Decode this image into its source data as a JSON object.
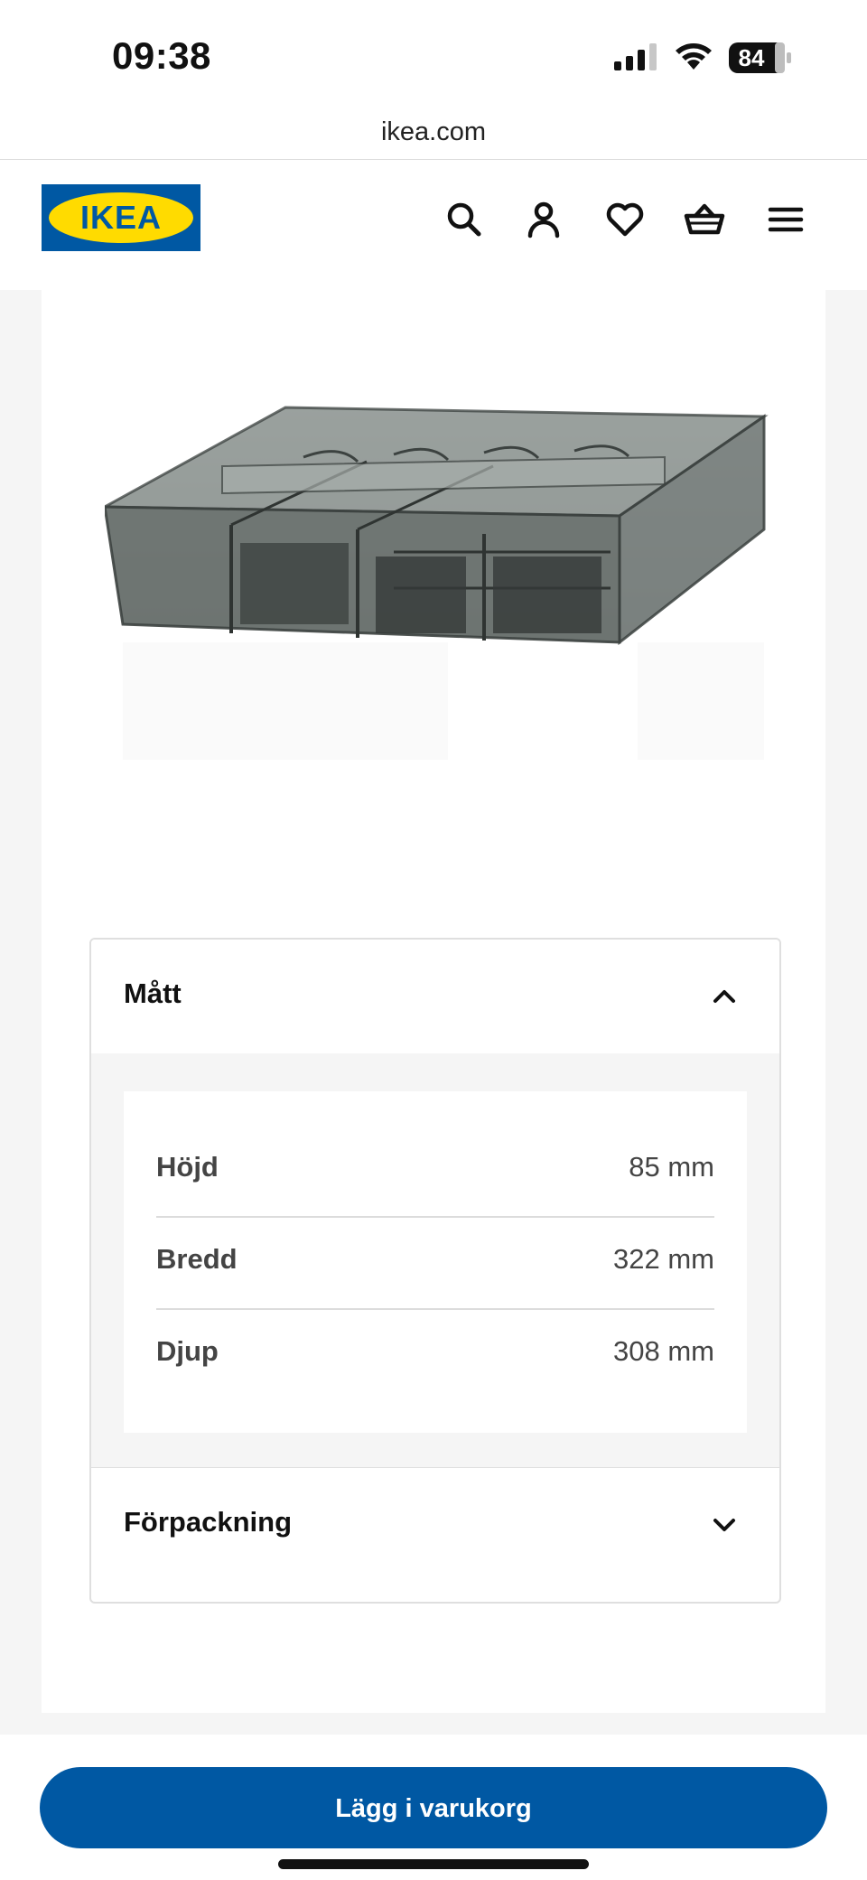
{
  "status_bar": {
    "time": "09:38",
    "battery": "84",
    "icons": [
      "signal-icon",
      "wifi-icon",
      "battery-icon"
    ]
  },
  "browser": {
    "url": "ikea.com"
  },
  "header": {
    "logo_text": "IKEA",
    "icons": [
      "search-icon",
      "account-icon",
      "heart-icon",
      "basket-icon",
      "menu-icon"
    ]
  },
  "dimensions_section": {
    "title": "Mått",
    "expanded": true,
    "rows": [
      {
        "label": "Höjd",
        "value": "85 mm"
      },
      {
        "label": "Bredd",
        "value": "322 mm"
      },
      {
        "label": "Djup",
        "value": "308 mm"
      }
    ]
  },
  "packaging_section": {
    "title": "Förpackning",
    "expanded": false
  },
  "cart": {
    "button_label": "Lägg i varukorg"
  },
  "colors": {
    "brand_blue": "#0058a3",
    "brand_yellow": "#ffdb00"
  }
}
